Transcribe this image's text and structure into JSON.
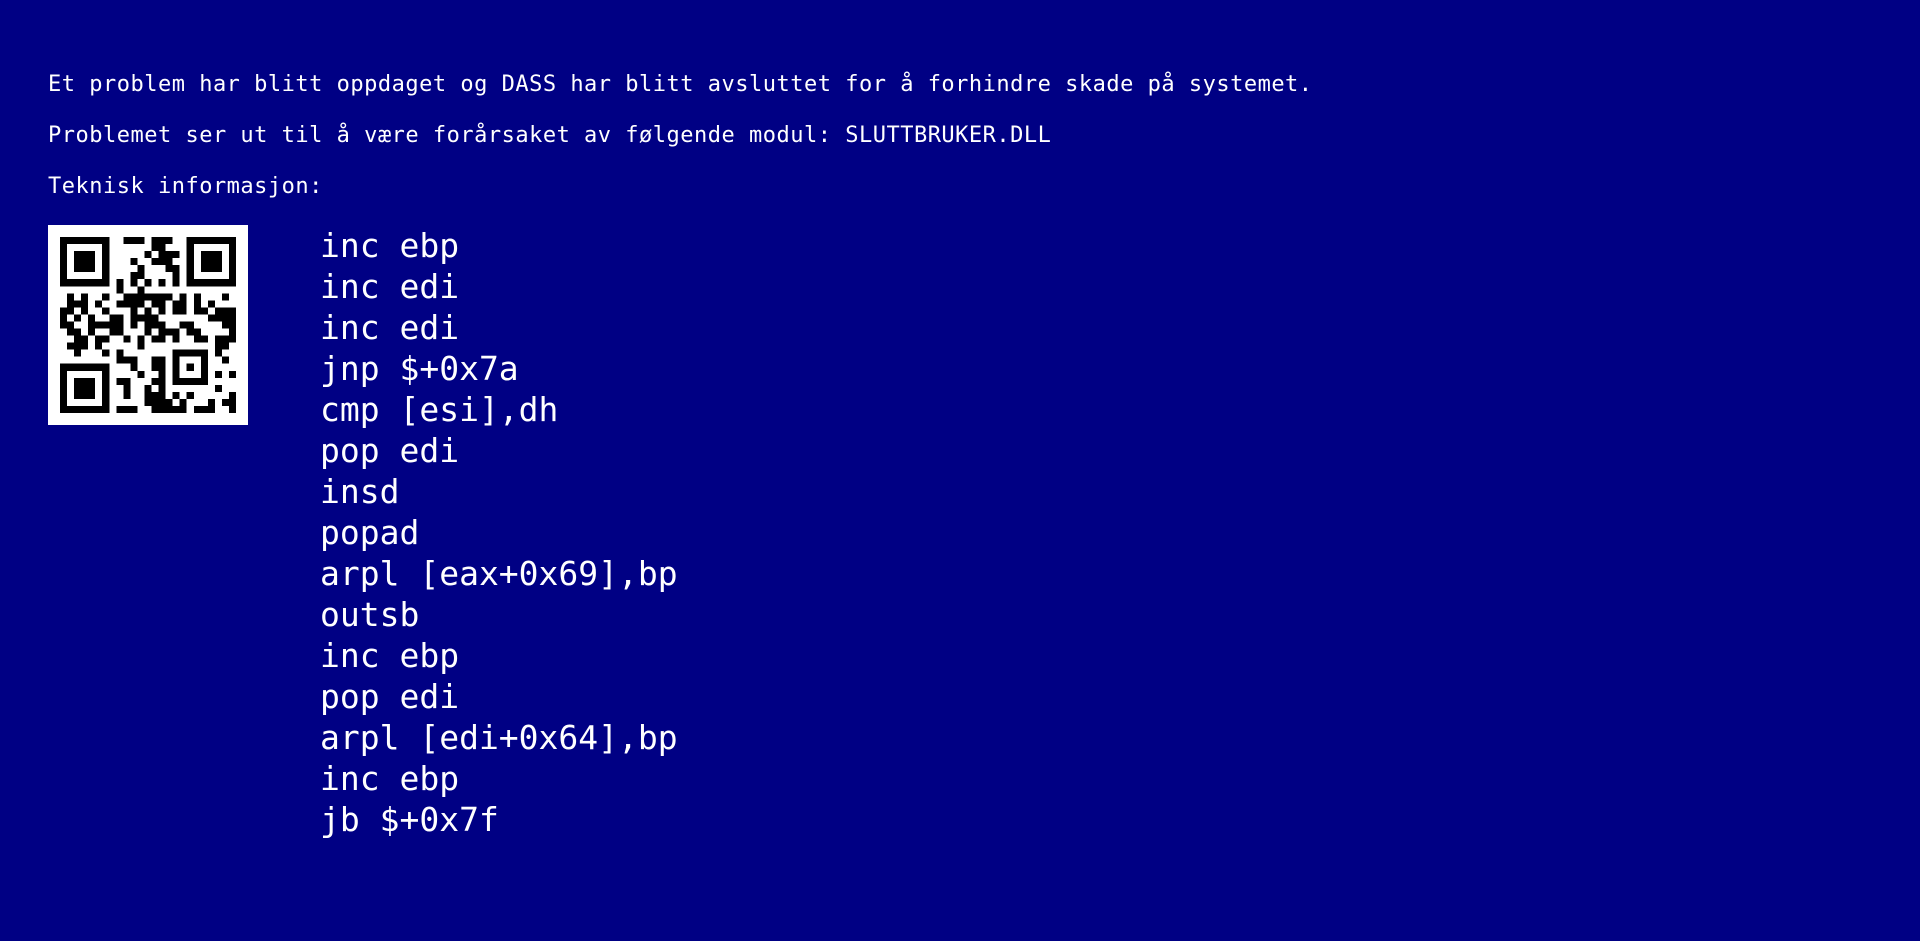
{
  "screen": {
    "background_color": "#000084",
    "text_color": "#ffffff",
    "message_line_1": "Et problem har blitt oppdaget og DASS har blitt avsluttet for å forhindre skade på systemet.",
    "message_line_2": "Problemet ser ut til å være forårsaket av følgende modul: SLUTTBRUKER.DLL",
    "tech_info_label": "Teknisk informasjon:",
    "qr_code_icon": "qr-code-icon",
    "assembly_lines": [
      "inc ebp",
      "inc edi",
      "inc edi",
      "jnp $+0x7a",
      "cmp [esi],dh",
      "pop edi",
      "insd",
      "popad",
      "arpl [eax+0x69],bp",
      "outsb",
      "inc ebp",
      "pop edi",
      "arpl [edi+0x64],bp",
      "inc ebp",
      "jb $+0x7f"
    ]
  }
}
